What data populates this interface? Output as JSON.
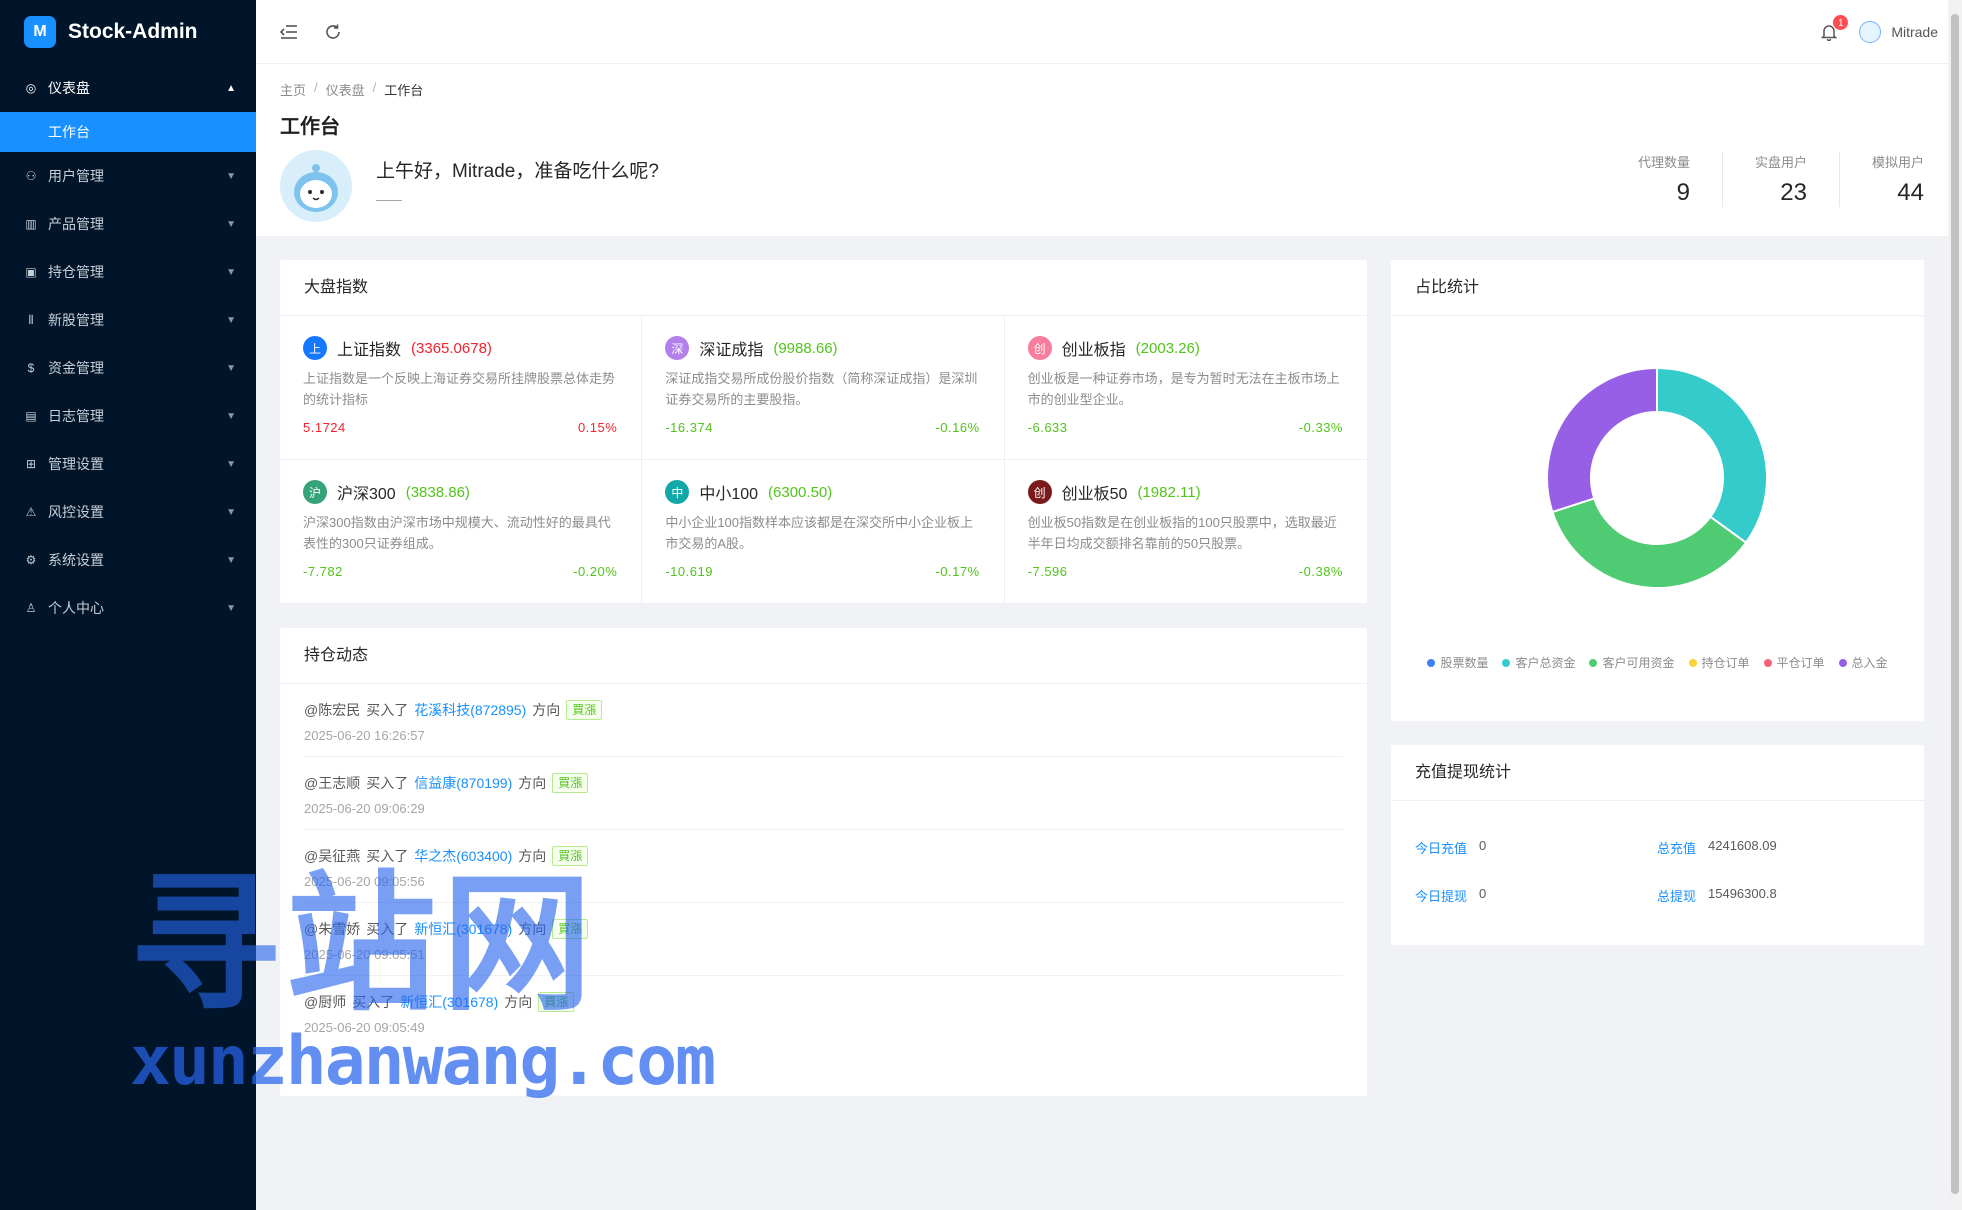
{
  "app": {
    "title": "Stock-Admin",
    "logo_glyph": "M"
  },
  "sidebar": {
    "items": [
      {
        "label": "仪表盘",
        "icon": "dashboard-icon",
        "glyph": "◎",
        "open": true,
        "children": [
          {
            "label": "工作台",
            "active": true
          }
        ]
      },
      {
        "label": "用户管理",
        "icon": "user-group-icon",
        "glyph": "⚇"
      },
      {
        "label": "产品管理",
        "icon": "bar-chart-icon",
        "glyph": "▥"
      },
      {
        "label": "持仓管理",
        "icon": "position-icon",
        "glyph": "▣"
      },
      {
        "label": "新股管理",
        "icon": "new-stock-icon",
        "glyph": "⦀"
      },
      {
        "label": "资金管理",
        "icon": "money-icon",
        "glyph": "$"
      },
      {
        "label": "日志管理",
        "icon": "log-icon",
        "glyph": "▤"
      },
      {
        "label": "管理设置",
        "icon": "admin-settings-icon",
        "glyph": "⊞"
      },
      {
        "label": "风控设置",
        "icon": "warning-icon",
        "glyph": "⚠"
      },
      {
        "label": "系统设置",
        "icon": "gear-icon",
        "glyph": "⚙"
      },
      {
        "label": "个人中心",
        "icon": "person-icon",
        "glyph": "♙"
      }
    ]
  },
  "header": {
    "notification_count": "1",
    "username": "Mitrade"
  },
  "breadcrumb": [
    "主页",
    "仪表盘",
    "工作台"
  ],
  "page": {
    "title": "工作台",
    "greeting": "上午好，Mitrade，准备吃什么呢?",
    "greeting_sub": "——"
  },
  "stats": [
    {
      "label": "代理数量",
      "value": "9"
    },
    {
      "label": "实盘用户",
      "value": "23"
    },
    {
      "label": "模拟用户",
      "value": "44"
    }
  ],
  "market": {
    "title": "大盘指数",
    "indices": [
      {
        "badge": "上",
        "badge_color": "#1677ff",
        "name": "上证指数",
        "value": "(3365.0678)",
        "value_color": "red",
        "desc": "上证指数是一个反映上海证券交易所挂牌股票总体走势的统计指标",
        "change": "5.1724",
        "percent": "0.15%",
        "trend": "red"
      },
      {
        "badge": "深",
        "badge_color": "#b37feb",
        "name": "深证成指",
        "value": "(9988.66)",
        "value_color": "green",
        "desc": "深证成指交易所成份股价指数（简称深证成指）是深圳证券交易所的主要股指。",
        "change": "-16.374",
        "percent": "-0.16%",
        "trend": "green"
      },
      {
        "badge": "创",
        "badge_color": "#f87d9c",
        "name": "创业板指",
        "value": "(2003.26)",
        "value_color": "green",
        "desc": "创业板是一种证券市场，是专为暂时无法在主板市场上市的创业型企业。",
        "change": "-6.633",
        "percent": "-0.33%",
        "trend": "green"
      },
      {
        "badge": "沪",
        "badge_color": "#36a37a",
        "name": "沪深300",
        "value": "(3838.86)",
        "value_color": "green",
        "desc": "沪深300指数由沪深市场中规模大、流动性好的最具代表性的300只证券组成。",
        "change": "-7.782",
        "percent": "-0.20%",
        "trend": "green"
      },
      {
        "badge": "中",
        "badge_color": "#13a8a8",
        "name": "中小100",
        "value": "(6300.50)",
        "value_color": "green",
        "desc": "中小企业100指数样本应该都是在深交所中小企业板上市交易的A股。",
        "change": "-10.619",
        "percent": "-0.17%",
        "trend": "green"
      },
      {
        "badge": "创",
        "badge_color": "#7a1a1a",
        "name": "创业板50",
        "value": "(1982.11)",
        "value_color": "green",
        "desc": "创业板50指数是在创业板指的100只股票中，选取最近半年日均成交额排名靠前的50只股票。",
        "change": "-7.596",
        "percent": "-0.38%",
        "trend": "green"
      }
    ]
  },
  "positions": {
    "title": "持仓动态",
    "items": [
      {
        "user": "@陈宏民",
        "action": "买入了",
        "stock": "花溪科技(872895)",
        "dir_label": "方向",
        "tag": "買漲",
        "time": "2025-06-20 16:26:57"
      },
      {
        "user": "@王志顺",
        "action": "买入了",
        "stock": "信益康(870199)",
        "dir_label": "方向",
        "tag": "買漲",
        "time": "2025-06-20 09:06:29"
      },
      {
        "user": "@吴征燕",
        "action": "买入了",
        "stock": "华之杰(603400)",
        "dir_label": "方向",
        "tag": "買漲",
        "time": "2025-06-20 09:05:56"
      },
      {
        "user": "@朱雪娇",
        "action": "买入了",
        "stock": "新恒汇(301678)",
        "dir_label": "方向",
        "tag": "買漲",
        "time": "2025-06-20 09:05:51"
      },
      {
        "user": "@厨师",
        "action": "买入了",
        "stock": "新恒汇(301678)",
        "dir_label": "方向",
        "tag": "買漲",
        "time": "2025-06-20 09:05:49"
      }
    ]
  },
  "ratio": {
    "title": "占比统计",
    "chart_data": {
      "type": "pie",
      "series": [
        {
          "name": "股票数量",
          "value": 0,
          "color": "#3b82f6"
        },
        {
          "name": "客户总资金",
          "value": 35,
          "color": "#36cbcb"
        },
        {
          "name": "客户可用资金",
          "value": 35,
          "color": "#4ecb73"
        },
        {
          "name": "持仓订单",
          "value": 0,
          "color": "#fbd437"
        },
        {
          "name": "平仓订单",
          "value": 0,
          "color": "#f2637b"
        },
        {
          "name": "总入金",
          "value": 30,
          "color": "#975fe5"
        }
      ]
    }
  },
  "recharge": {
    "title": "充值提现统计",
    "rows": [
      [
        {
          "label": "今日充值",
          "value": "0"
        },
        {
          "label": "总充值",
          "value": "4241608.09"
        }
      ],
      [
        {
          "label": "今日提现",
          "value": "0"
        },
        {
          "label": "总提现",
          "value": "15496300.8"
        }
      ]
    ]
  },
  "watermark": {
    "big": "寻站网",
    "small": "xunzhanwang.com"
  },
  "colors": {
    "primary": "#1890ff",
    "sidebar_bg": "#001529",
    "up": "#f5222d",
    "down": "#52c41a"
  }
}
